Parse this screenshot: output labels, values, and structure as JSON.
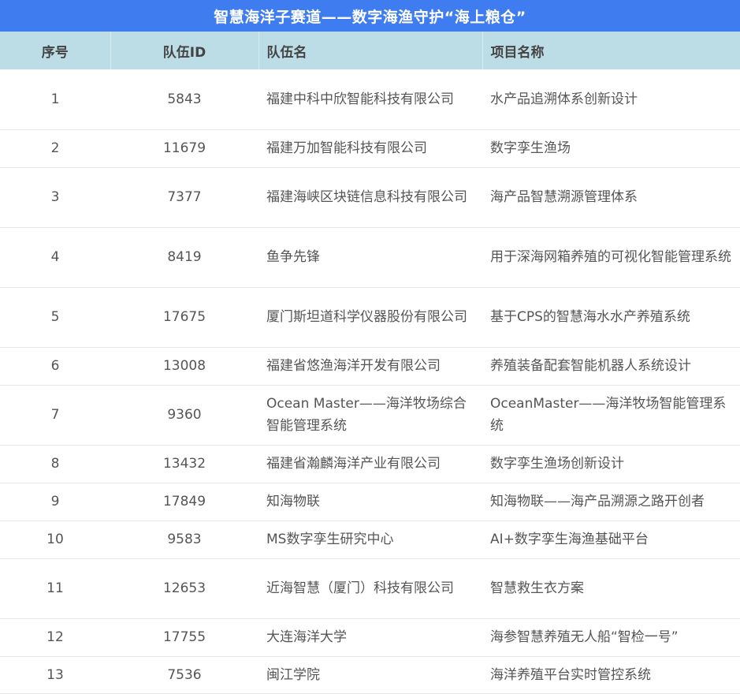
{
  "header": {
    "title": "智慧海洋子赛道——数字海渔守护“海上粮仓”"
  },
  "table": {
    "columns": [
      "序号",
      "队伍ID",
      "队伍名",
      "项目名称"
    ],
    "rows": [
      {
        "no": "1",
        "id": "5843",
        "team": "福建中科中欣智能科技有限公司",
        "project": "水产品追溯体系创新设计"
      },
      {
        "no": "2",
        "id": "11679",
        "team": "福建万加智能科技有限公司",
        "project": "数字孪生渔场"
      },
      {
        "no": "3",
        "id": "7377",
        "team": "福建海峡区块链信息科技有限公司",
        "project": "海产品智慧溯源管理体系"
      },
      {
        "no": "4",
        "id": "8419",
        "team": "鱼争先锋",
        "project": "用于深海网箱养殖的可视化智能管理系统"
      },
      {
        "no": "5",
        "id": "17675",
        "team": "厦门斯坦道科学仪器股份有限公司",
        "project": "基于CPS的智慧海水水产养殖系统"
      },
      {
        "no": "6",
        "id": "13008",
        "team": "福建省悠渔海洋开发有限公司",
        "project": "养殖装备配套智能机器人系统设计"
      },
      {
        "no": "7",
        "id": "9360",
        "team": "Ocean Master——海洋牧场综合智能管理系统",
        "project": "OceanMaster——海洋牧场智能管理系统"
      },
      {
        "no": "8",
        "id": "13432",
        "team": "福建省瀚麟海洋产业有限公司",
        "project": "数字孪生渔场创新设计"
      },
      {
        "no": "9",
        "id": "17849",
        "team": "知海物联",
        "project": "知海物联——海产品溯源之路开创者"
      },
      {
        "no": "10",
        "id": "9583",
        "team": "MS数字孪生研究中心",
        "project": "AI+数字孪生海渔基础平台"
      },
      {
        "no": "11",
        "id": "12653",
        "team": "近海智慧（厦门）科技有限公司",
        "project": "智慧救生衣方案"
      },
      {
        "no": "12",
        "id": "17755",
        "team": "大连海洋大学",
        "project": "海参智慧养殖无人船“智检一号”"
      },
      {
        "no": "13",
        "id": "7536",
        "team": "闽江学院",
        "project": "海洋养殖平台实时管控系统"
      }
    ]
  }
}
